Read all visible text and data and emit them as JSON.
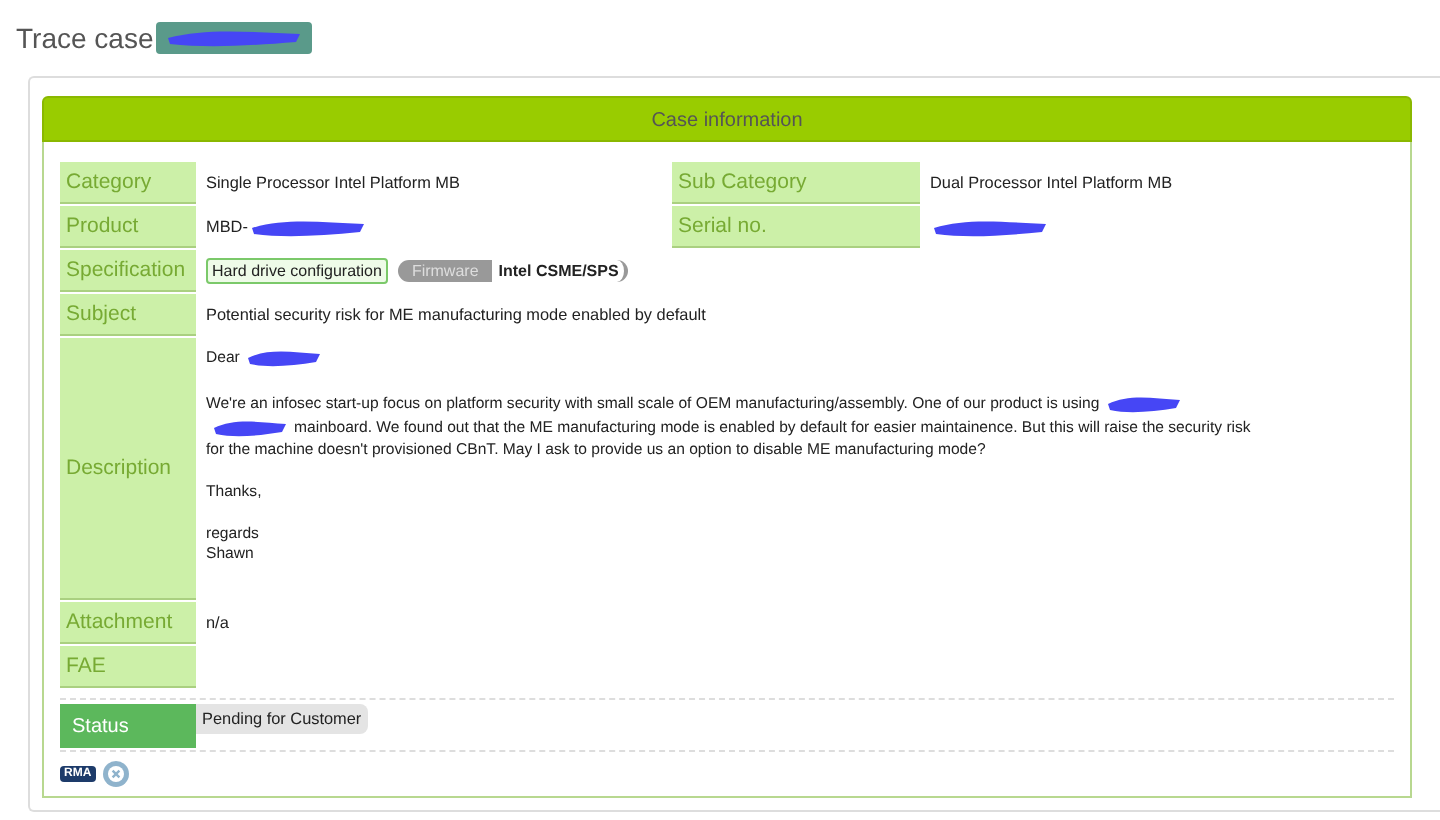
{
  "page_title": {
    "text": "Trace case",
    "redacted": true
  },
  "panel": {
    "title": "Case information"
  },
  "fields": [
    {
      "kind": "pair",
      "label": "Category",
      "value": "Single Processor Intel Platform MB",
      "label_2": "Sub Category",
      "value_2": "Dual Processor Intel Platform MB"
    },
    {
      "kind": "pair",
      "label": "Product",
      "value": "MBD-",
      "value_redacted": true,
      "label_2": "Serial no.",
      "value_2_redacted": true
    },
    {
      "kind": "spec",
      "label": "Specification",
      "tag": "Hard drive configuration",
      "chip": "Firmware",
      "chip_value": "Intel CSME/SPS"
    },
    {
      "kind": "text",
      "label": "Subject",
      "value": "Potential security risk for ME manufacturing mode enabled by default"
    },
    {
      "kind": "description",
      "label": "Description",
      "paragraphs": [
        {
          "parts": [
            {
              "kind": "text",
              "text": "Dear"
            },
            {
              "kind": "redacted"
            }
          ]
        },
        {
          "parts": [
            {
              "kind": "text",
              "text": "We're an infosec start-up focus on platform security with small scale of OEM manufacturing/assembly. One of our product is using"
            },
            {
              "kind": "redacted"
            },
            {
              "kind": "break"
            },
            {
              "kind": "redacted"
            },
            {
              "kind": "text",
              "text": "mainboard. We found out that the ME manufacturing mode is enabled by default for easier maintainence. But this will raise the security risk"
            },
            {
              "kind": "break"
            },
            {
              "kind": "text",
              "text": "for the machine doesn't provisioned CBnT. May I ask to provide us an option to disable ME manufacturing mode?"
            }
          ]
        },
        {
          "parts": [
            {
              "kind": "text",
              "text": "Thanks,"
            }
          ]
        },
        {
          "parts": [
            {
              "kind": "text",
              "text": "regards"
            },
            {
              "kind": "break"
            },
            {
              "kind": "text",
              "text": "Shawn"
            }
          ]
        }
      ]
    },
    {
      "kind": "text",
      "label": "Attachment",
      "value": "n/a"
    },
    {
      "kind": "text",
      "label": "FAE"
    }
  ],
  "status": {
    "label": "Status",
    "value": "Pending for Customer"
  },
  "actions": [
    {
      "kind": "badge",
      "text": "RMA"
    },
    {
      "kind": "close"
    }
  ]
}
